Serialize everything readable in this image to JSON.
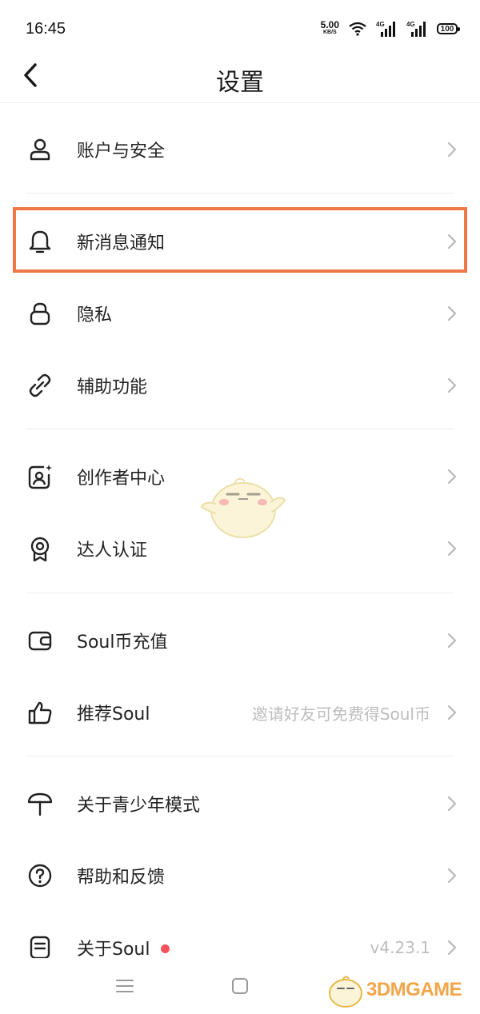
{
  "status": {
    "time": "16:45",
    "speed_value": "5.00",
    "speed_unit": "KB/S",
    "network_1": "4G",
    "network_2": "4G",
    "battery": "100"
  },
  "header": {
    "title": "设置"
  },
  "menu": {
    "account": {
      "label": "账户与安全",
      "icon": "user-icon"
    },
    "notification": {
      "label": "新消息通知",
      "icon": "bell-icon"
    },
    "privacy": {
      "label": "隐私",
      "icon": "lock-icon"
    },
    "accessibility": {
      "label": "辅助功能",
      "icon": "link-icon"
    },
    "creator": {
      "label": "创作者中心",
      "icon": "creator-icon"
    },
    "certification": {
      "label": "达人认证",
      "icon": "badge-icon"
    },
    "recharge": {
      "label": "Soul币充值",
      "icon": "wallet-icon"
    },
    "recommend": {
      "label": "推荐Soul",
      "subtitle": "邀请好友可免费得Soul币",
      "icon": "thumbs-up-icon"
    },
    "youth": {
      "label": "关于青少年模式",
      "icon": "umbrella-icon"
    },
    "help": {
      "label": "帮助和反馈",
      "icon": "help-icon"
    },
    "about": {
      "label": "关于Soul",
      "version": "v4.23.1",
      "icon": "info-icon"
    }
  },
  "watermark": {
    "text": "3DMGAME"
  },
  "colors": {
    "highlight": "#f07848",
    "badge_dot": "#f0545a",
    "chevron": "#b8b8b8",
    "subtitle": "#bdbdbd"
  }
}
